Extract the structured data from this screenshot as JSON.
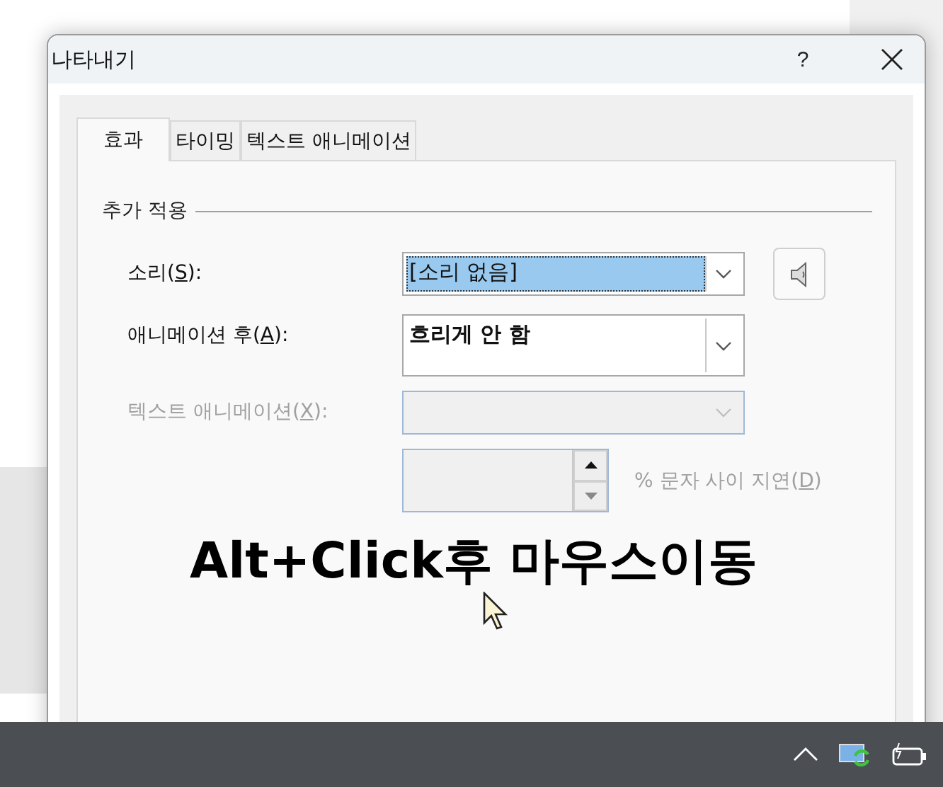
{
  "window": {
    "title": "나타내기",
    "help": "?"
  },
  "tabs": [
    {
      "label": "효과",
      "selected": true
    },
    {
      "label": "타이밍",
      "selected": false
    },
    {
      "label": "텍스트 애니메이션",
      "selected": false
    }
  ],
  "group": {
    "title": "추가 적용"
  },
  "fields": [
    {
      "kind": "combo",
      "label": {
        "before": "소리(",
        "key": "S",
        "after": "):"
      },
      "value": "[소리 없음]",
      "highlighted": true,
      "disabled": false,
      "speaker_button": true
    },
    {
      "kind": "tall-combo",
      "label": {
        "before": "애니메이션 후(",
        "key": "A",
        "after": "):"
      },
      "value": "흐리게 안 함",
      "highlighted": false,
      "disabled": false
    },
    {
      "kind": "combo",
      "label": {
        "before": "텍스트 애니메이션(",
        "key": "X",
        "after": "):"
      },
      "disabled": true
    },
    {
      "kind": "spinner",
      "label": {
        "before": "% 문자 사이 지연(",
        "key": "D",
        "after": ")"
      },
      "disabled": true
    }
  ],
  "annotation": "Alt+Click후 마우스이동"
}
